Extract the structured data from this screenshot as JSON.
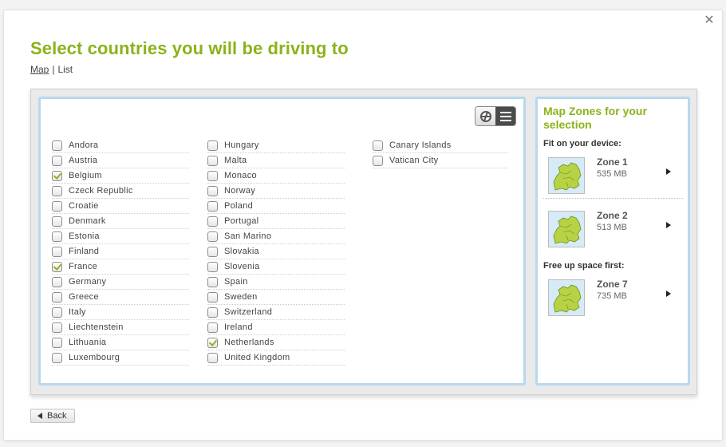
{
  "dialog": {
    "title": "Select countries you will be driving to",
    "close_glyph": "✕",
    "view_links": {
      "map": "Map",
      "separator": "|",
      "list": "List"
    }
  },
  "colors": {
    "accent": "#8ab31a",
    "panel_border": "#b8d8ee"
  },
  "view_toggle": {
    "map_icon": "globe-icon",
    "list_icon": "list-icon",
    "active": "list"
  },
  "columns": [
    [
      {
        "label": "Andora",
        "checked": false
      },
      {
        "label": "Austria",
        "checked": false
      },
      {
        "label": "Belgium",
        "checked": true
      },
      {
        "label": "Czeck Republic",
        "checked": false
      },
      {
        "label": "Croatie",
        "checked": false
      },
      {
        "label": "Denmark",
        "checked": false
      },
      {
        "label": "Estonia",
        "checked": false
      },
      {
        "label": "Finland",
        "checked": false
      },
      {
        "label": "France",
        "checked": true
      },
      {
        "label": "Germany",
        "checked": false
      },
      {
        "label": "Greece",
        "checked": false
      },
      {
        "label": "Italy",
        "checked": false
      },
      {
        "label": "Liechtenstein",
        "checked": false
      },
      {
        "label": "Lithuania",
        "checked": false
      },
      {
        "label": "Luxembourg",
        "checked": false
      }
    ],
    [
      {
        "label": "Hungary",
        "checked": false
      },
      {
        "label": "Malta",
        "checked": false
      },
      {
        "label": "Monaco",
        "checked": false
      },
      {
        "label": "Norway",
        "checked": false
      },
      {
        "label": "Poland",
        "checked": false
      },
      {
        "label": "Portugal",
        "checked": false
      },
      {
        "label": "San Marino",
        "checked": false
      },
      {
        "label": "Slovakia",
        "checked": false
      },
      {
        "label": "Slovenia",
        "checked": false
      },
      {
        "label": "Spain",
        "checked": false
      },
      {
        "label": "Sweden",
        "checked": false
      },
      {
        "label": "Switzerland",
        "checked": false
      },
      {
        "label": "Ireland",
        "checked": false
      },
      {
        "label": "Netherlands",
        "checked": true
      },
      {
        "label": "United Kingdom",
        "checked": false
      }
    ],
    [
      {
        "label": "Canary Islands",
        "checked": false
      },
      {
        "label": "Vatican City",
        "checked": false
      }
    ]
  ],
  "sidebar": {
    "title": "Map Zones for your selection",
    "fit_label": "Fit on your device:",
    "free_label": "Free up space first:",
    "zones": [
      {
        "name": "Zone 1",
        "size": "535 MB",
        "icon": "europe-map-thumbnail"
      },
      {
        "name": "Zone 2",
        "size": "513 MB",
        "icon": "europe-map-thumbnail"
      },
      {
        "name": "Zone 7",
        "size": "735 MB",
        "icon": "europe-map-thumbnail"
      }
    ]
  },
  "back_button": {
    "label": "Back",
    "icon": "arrow-left-icon"
  }
}
